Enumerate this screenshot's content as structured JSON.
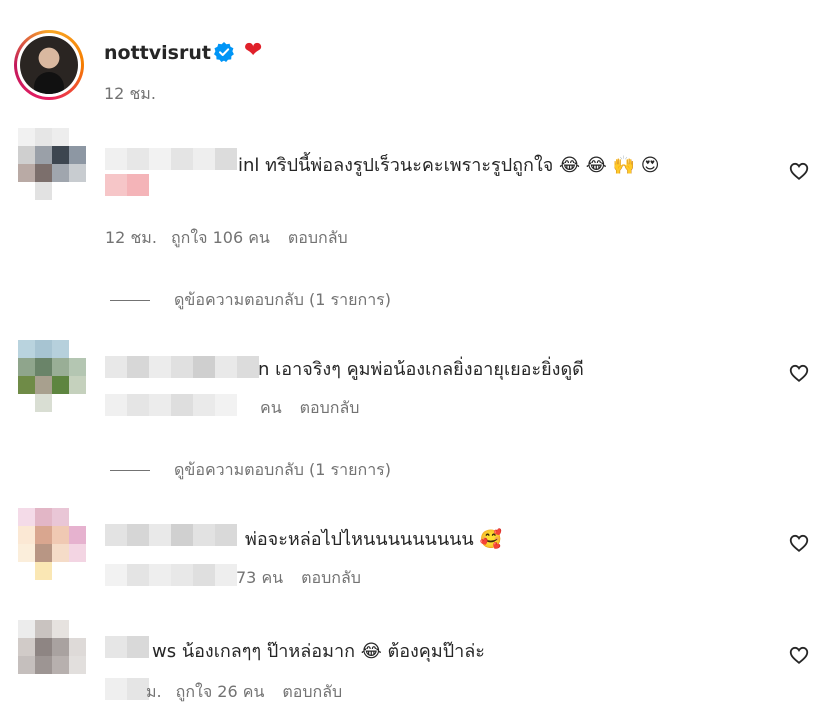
{
  "post": {
    "username": "nottvisrut",
    "verified_icon": "verified-badge-icon",
    "heart": "❤",
    "time": "12 ชม."
  },
  "comments": [
    {
      "text": "inl ทริปนี้พ่อลงรูปเร็วนะคะเพราะรูปถูกใจ",
      "emojis": [
        "😂",
        "😂",
        "🙌",
        "😍"
      ],
      "time": "12 ชม.",
      "likes": "ถูกใจ 106 คน",
      "reply": "ตอบกลับ",
      "view_replies": "ดูข้อความตอบกลับ (1 รายการ)"
    },
    {
      "text": "n เอาจริงๆ คูมพ่อน้องเกลยิ่งอายุเยอะยิ่งดูดี",
      "emojis": [],
      "likes": "คน",
      "reply": "ตอบกลับ",
      "view_replies": "ดูข้อความตอบกลับ (1 รายการ)"
    },
    {
      "text": "พ่อจะหล่อไปไหนนนนนนนนน",
      "emojis": [
        "🥰"
      ],
      "likes": "73 คน",
      "reply": "ตอบกลับ"
    },
    {
      "text": "ws น้องเกลๆๆ ป๊าหล่อมาก",
      "text2": "ต้องคุมป๊าล่ะ",
      "emojis": [
        "😂"
      ],
      "time": "ม.",
      "likes": "ถูกใจ 26 คน",
      "reply": "ตอบกลับ"
    }
  ]
}
